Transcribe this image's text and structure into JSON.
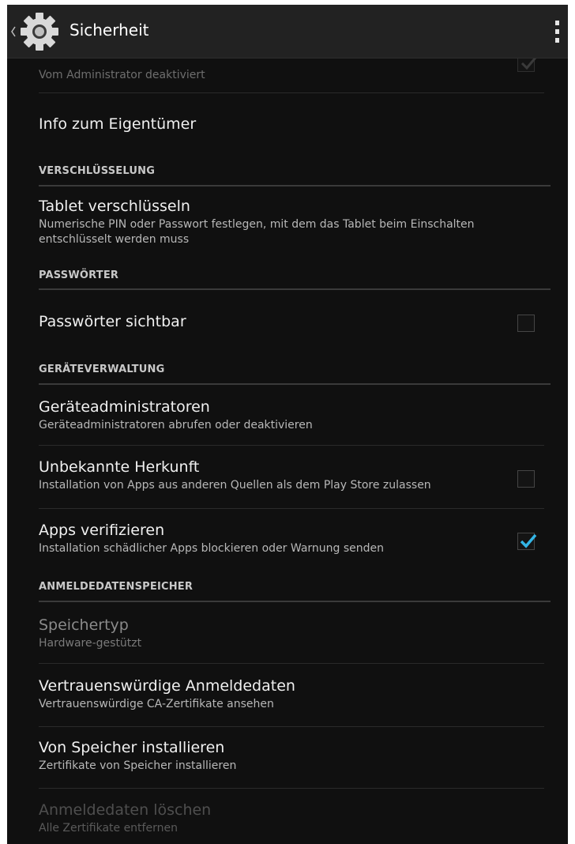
{
  "actionbar": {
    "title": "Sicherheit"
  },
  "partial_item": {
    "summary": "Vom Administrator deaktiviert"
  },
  "owner_info": {
    "title": "Info zum Eigentümer"
  },
  "categories": {
    "encryption": "VERSCHLÜSSELUNG",
    "passwords": "PASSWÖRTER",
    "device_admin": "GERÄTEVERWALTUNG",
    "credential_storage": "ANMELDEDATENSPEICHER"
  },
  "items": {
    "encrypt_tablet": {
      "title": "Tablet verschlüsseln",
      "summary": "Numerische PIN oder Passwort festlegen, mit dem das Tablet beim Einschalten entschlüsselt werden muss"
    },
    "show_passwords": {
      "title": "Passwörter sichtbar",
      "checked": false
    },
    "device_admins": {
      "title": "Geräteadministratoren",
      "summary": "Geräteadministratoren abrufen oder deaktivieren"
    },
    "unknown_sources": {
      "title": "Unbekannte Herkunft",
      "summary": "Installation von Apps aus anderen Quellen als dem Play Store zulassen",
      "checked": false
    },
    "verify_apps": {
      "title": "Apps verifizieren",
      "summary": "Installation schädlicher Apps blockieren oder Warnung senden",
      "checked": true
    },
    "storage_type": {
      "title": "Speichertyp",
      "summary": "Hardware-gestützt"
    },
    "trusted_credentials": {
      "title": "Vertrauenswürdige Anmeldedaten",
      "summary": "Vertrauenswürdige CA-Zertifikate ansehen"
    },
    "install_from_storage": {
      "title": "Von Speicher installieren",
      "summary": "Zertifikate von Speicher installieren"
    },
    "clear_credentials": {
      "title": "Anmeldedaten löschen",
      "summary": "Alle Zertifikate entfernen"
    }
  },
  "colors": {
    "background": "#101010",
    "actionbar": "#222222",
    "accent_check": "#33b5e5"
  }
}
